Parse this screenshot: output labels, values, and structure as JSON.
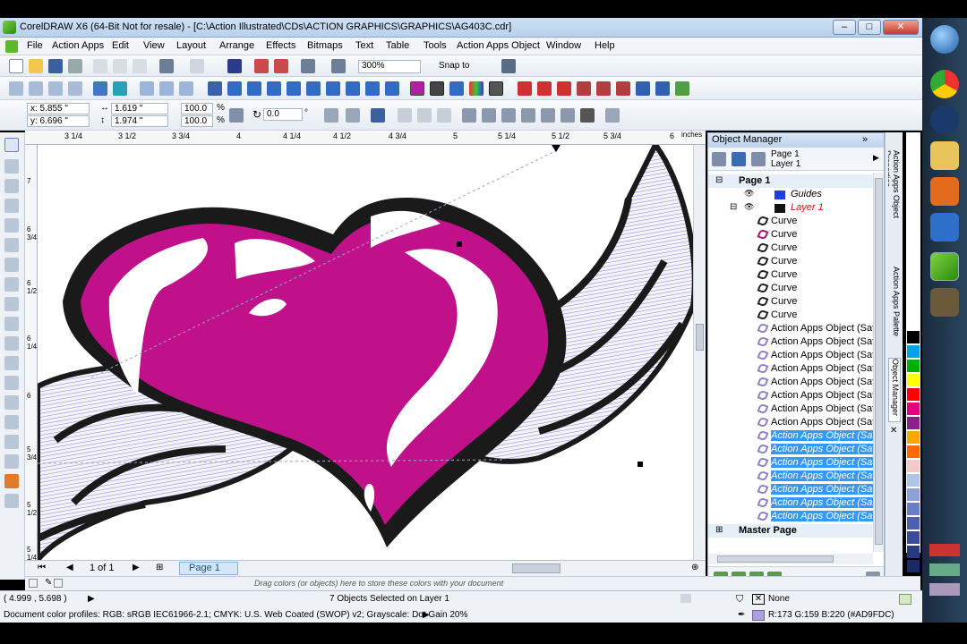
{
  "title_bar": {
    "title": "CorelDRAW X6 (64-Bit Not for resale) - [C:\\Action Illustrated\\CDs\\ACTION GRAPHICS\\GRAPHICS\\AG403C.cdr]"
  },
  "menu": [
    "File",
    "Action Apps",
    "Edit",
    "View",
    "Layout",
    "Arrange",
    "Effects",
    "Bitmaps",
    "Text",
    "Table",
    "Tools",
    "Action Apps Object",
    "Window",
    "Help"
  ],
  "standard_toolbar": {
    "zoom": "300%",
    "snap_to": "Snap to"
  },
  "property_bar": {
    "x": "x: 5.855 \"",
    "y": "y: 6.696 \"",
    "w": "1.619 \"",
    "h": "1.974 \"",
    "scale_w": "100.0",
    "scale_h": "100.0",
    "pct1": "%",
    "pct2": "%",
    "angle": "0.0",
    "deg": "°"
  },
  "rulers": {
    "top": [
      "3 1/4",
      "3 1/2",
      "3 3/4",
      "4",
      "4 1/4",
      "4 1/2",
      "4 3/4",
      "5",
      "5 1/4",
      "5 1/2",
      "5 3/4",
      "6"
    ],
    "unit": "inches",
    "left": [
      "7",
      "6 3/4",
      "6 1/2",
      "6 1/4",
      "6",
      "5 3/4",
      "5 1/2",
      "5 1/4"
    ]
  },
  "page_nav": {
    "count": "1 of 1",
    "tab": "Page 1"
  },
  "object_manager": {
    "title": "Object Manager",
    "page_label": "Page 1",
    "layer_label": "Layer 1",
    "tree": {
      "page": "Page 1",
      "guides": "Guides",
      "layer": "Layer 1",
      "curves": [
        "Curve",
        "Curve",
        "Curve",
        "Curve",
        "Curve",
        "Curve",
        "Curve",
        "Curve"
      ],
      "objects": [
        "Action Apps Object (Satin)",
        "Action Apps Object (Satin)",
        "Action Apps Object (Satin)",
        "Action Apps Object (Satin)",
        "Action Apps Object (Satin)",
        "Action Apps Object (Satin)",
        "Action Apps Object (Satin)",
        "Action Apps Object (Satin)"
      ],
      "selected_objects": [
        "Action Apps Object (Satin)",
        "Action Apps Object (Satin)",
        "Action Apps Object (Satin)",
        "Action Apps Object (Satin)",
        "Action Apps Object (Satin)",
        "Action Apps Object (Satin)",
        "Action Apps Object (Satin)"
      ],
      "master": "Master Page"
    }
  },
  "docker_tabs": [
    "Action Apps Object Properties",
    "Action Apps Palette",
    "Object Manager"
  ],
  "colors": {
    "palette": [
      "#ffffff",
      "#000000",
      "#00a2e8",
      "#00b000",
      "#ffff00",
      "#ff0000",
      "#e4007c",
      "#8a1f8e",
      "#ffa500",
      "#ff6a00",
      "#f5c9c9",
      "#b0c4e8",
      "#8da0d8",
      "#6a7ec8",
      "#4f5fb0",
      "#3a4a98",
      "#2a3a80",
      "#1a2a68"
    ],
    "design_fill": "#c1118a",
    "design_outline": "#1a1a1a",
    "satin": "#ad9fdc",
    "selection": "#3399ff"
  },
  "color_bar": {
    "hint": "Drag colors (or objects) here to store these colors with your document"
  },
  "status": {
    "coords": "( 4.999 , 5.698 )",
    "selection": "7 Objects Selected on Layer 1",
    "profiles": "Document color profiles: RGB: sRGB IEC61966-2.1; CMYK: U.S. Web Coated (SWOP) v2; Grayscale: Dot Gain 20%",
    "fill_none": "None",
    "outline_color": "R:173 G:159 B:220 (#AD9FDC)"
  }
}
